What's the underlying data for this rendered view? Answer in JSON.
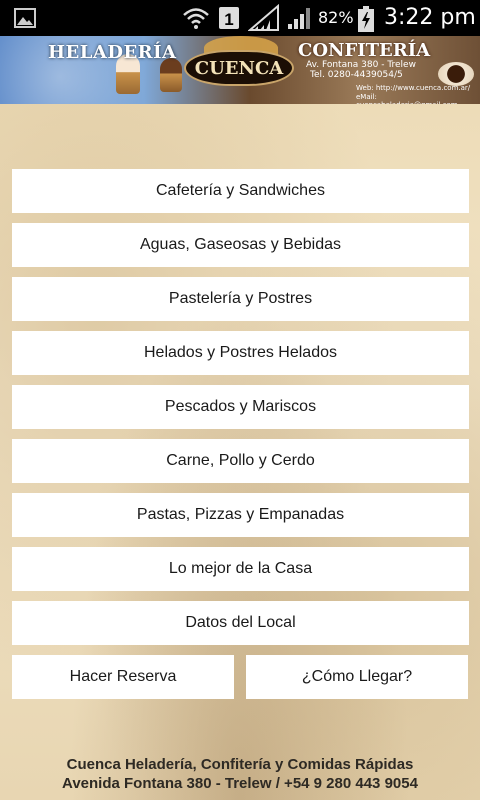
{
  "status_bar": {
    "battery_percent": "82%",
    "time": "3:22 pm",
    "sim_label": "1",
    "icons": [
      "gallery-icon",
      "wifi-icon",
      "sim-icon",
      "signal-icon",
      "signal-icon",
      "battery-charging-icon"
    ]
  },
  "banner": {
    "left_title": "HELADERÍA",
    "center_title": "CUENCA",
    "right_title": "CONFITERÍA",
    "address": "Av. Fontana 380 - Trelew",
    "tel": "Tel. 0280-4439054/5",
    "web": "Web: http://www.cuenca.com.ar/",
    "mail": "eMail: cuencaheladeria@gmail.com"
  },
  "menu": {
    "items": [
      "Cafetería y Sandwiches",
      "Aguas, Gaseosas y Bebidas",
      "Pastelería y Postres",
      "Helados y Postres Helados",
      "Pescados y Mariscos",
      "Carne, Pollo y Cerdo",
      "Pastas, Pizzas y Empanadas",
      "Lo mejor de la Casa",
      "Datos del Local"
    ],
    "reserve_label": "Hacer Reserva",
    "directions_label": "¿Cómo Llegar?"
  },
  "footer": {
    "line1": "Cuenca Heladería, Confitería y Comidas Rápidas",
    "line2": "Avenida Fontana 380 - Trelew / +54 9 280 443 9054"
  },
  "colors": {
    "status_bar": "#000000",
    "button_bg": "#ffffff",
    "parchment": "#efe2c6",
    "footer_text": "#2e2a24"
  }
}
